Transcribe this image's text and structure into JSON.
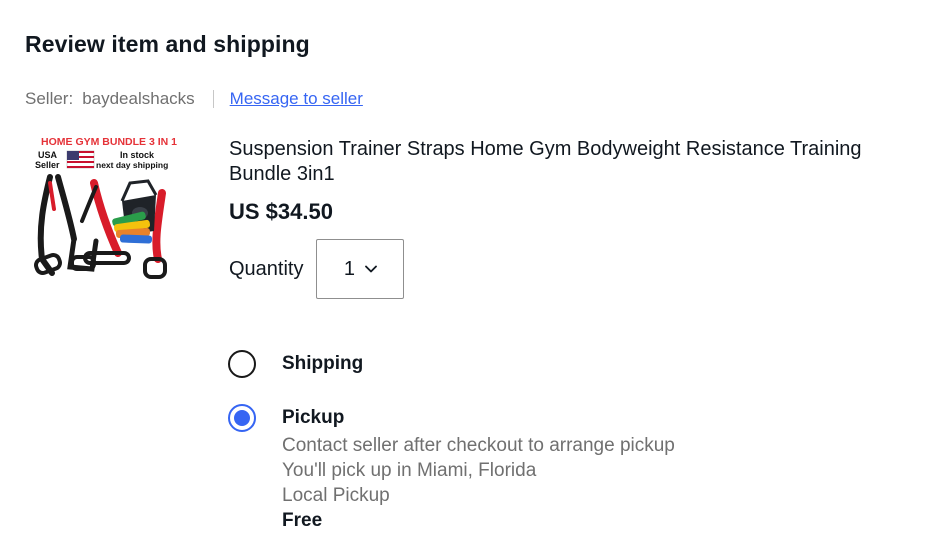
{
  "section": {
    "title": "Review item and shipping"
  },
  "seller": {
    "prefix": "Seller:",
    "name": "baydealshacks",
    "message_link": "Message to seller"
  },
  "item": {
    "image": {
      "banner_line1": "HOME GYM BUNDLE 3 IN 1",
      "badge_line1": "USA",
      "badge_line2": "Seller",
      "stock_line1": "In stock",
      "stock_line2": "next day shipping"
    },
    "title": "Suspension Trainer Straps Home Gym Bodyweight Resistance Training Bundle 3in1",
    "price": "US $34.50",
    "quantity": {
      "label": "Quantity",
      "value": "1"
    }
  },
  "delivery": {
    "options": [
      {
        "label": "Shipping",
        "selected": false
      },
      {
        "label": "Pickup",
        "selected": true,
        "details": [
          "Contact seller after checkout to arrange pickup",
          "You'll pick up in Miami, Florida",
          "Local Pickup"
        ],
        "cost": "Free"
      }
    ]
  },
  "colors": {
    "accent": "#3665f3",
    "text": "#111820",
    "muted": "#707070",
    "image_banner": "#e53238",
    "strap_red": "#d81c2a"
  }
}
